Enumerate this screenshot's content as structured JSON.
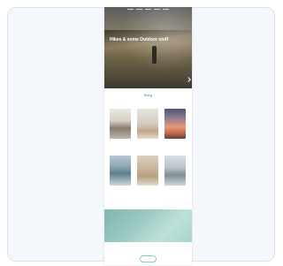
{
  "hero": {
    "title": "Hikes & some Outdoor stuff",
    "subtitle": ""
  },
  "section": {
    "title": "Blog"
  },
  "tiles": [
    {
      "caption": ""
    },
    {
      "caption": ""
    },
    {
      "caption": ""
    },
    {
      "caption": ""
    },
    {
      "caption": ""
    },
    {
      "caption": ""
    }
  ],
  "banner": {
    "text": ""
  },
  "footer": {
    "col1": "",
    "col2": "",
    "col3": ""
  },
  "colors": {
    "accent": "#4db6ac",
    "card_bg": "#f4f8fd",
    "card_border": "#d7e3f0"
  }
}
